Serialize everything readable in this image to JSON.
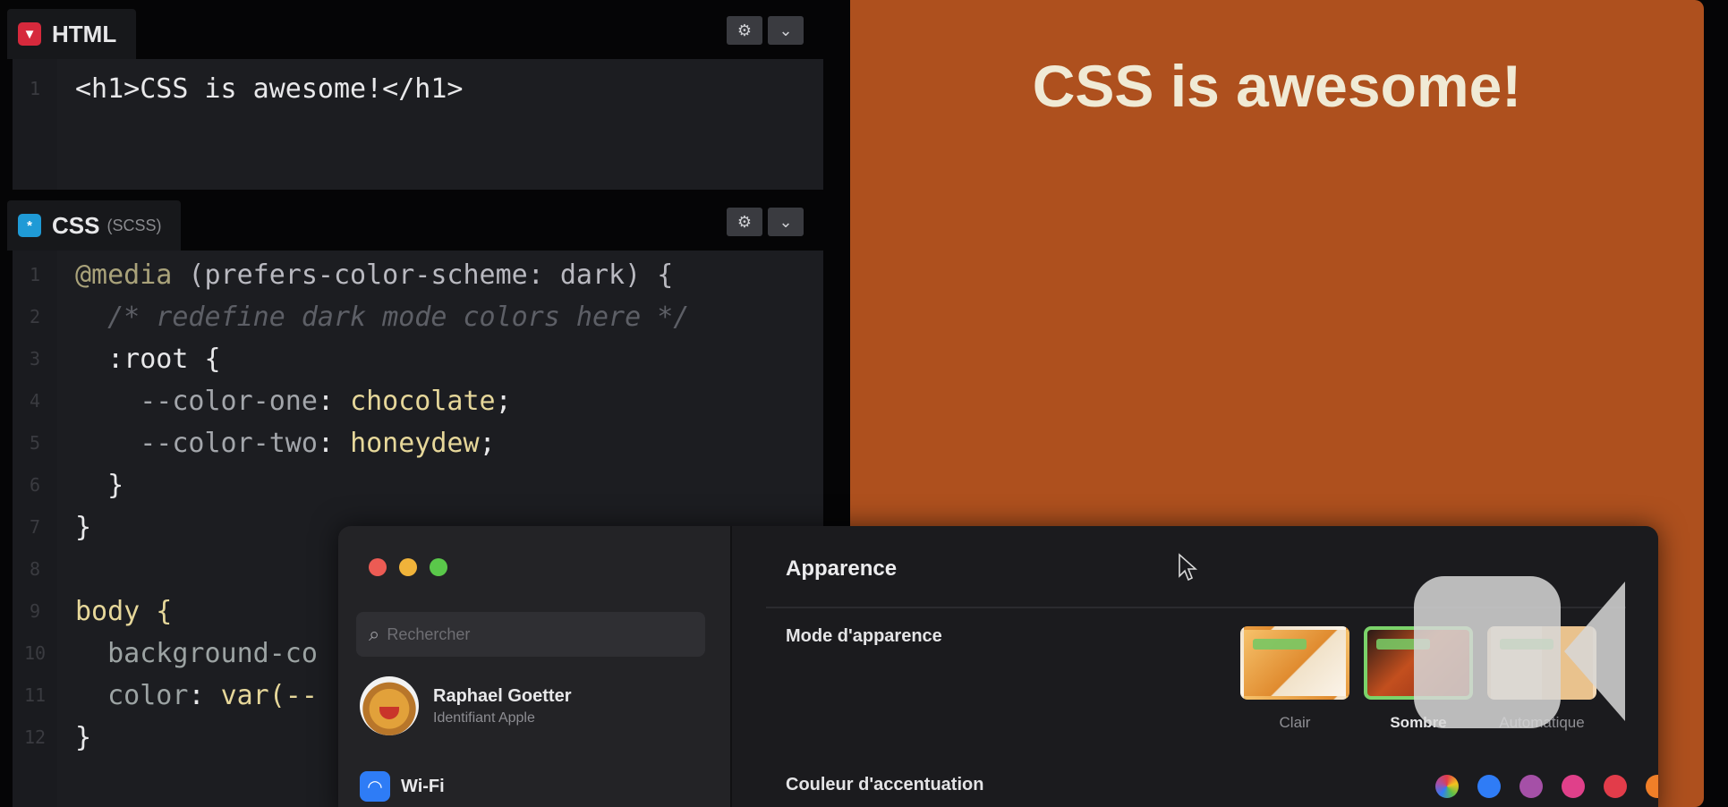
{
  "html_panel": {
    "tab_label": "HTML",
    "code": "<h1>CSS is awesome!</h1>"
  },
  "css_panel": {
    "tab_label": "CSS",
    "tab_sub": "(SCSS)",
    "lines": {
      "l1_at": "@media",
      "l1_rest": " (prefers-color-scheme: dark) {",
      "l2": "/* redefine dark mode colors here */",
      "l3": ":root {",
      "l4_prop": "--color-one",
      "l4_val": "chocolate",
      "l5_prop": "--color-two",
      "l5_val": "honeydew",
      "l6": "}",
      "l7": "}",
      "l8": "body {",
      "l9": "background-co",
      "l10_prop": "color",
      "l10_val": "var(--",
      "l11": "}"
    }
  },
  "preview": {
    "heading": "CSS is awesome!",
    "background": "#ae501e",
    "text_color": "#f0ead5"
  },
  "settings": {
    "search_placeholder": "Rechercher",
    "user_name": "Raphael Goetter",
    "user_sub": "Identifiant Apple",
    "wifi_label": "Wi-Fi",
    "pane_title": "Apparence",
    "mode_label": "Mode d'apparence",
    "modes": [
      "Clair",
      "Sombre",
      "Automatique"
    ],
    "selected_mode": "Sombre",
    "accent_label": "Couleur d'accentuation",
    "accent_colors": [
      "#c05be0",
      "#2f7cf6",
      "#a550a7",
      "#e0408a",
      "#e23c4a",
      "#f07f28",
      "#f2c21d",
      "#5bbf49",
      "#8d8d8d"
    ]
  },
  "icons": {
    "camera": "video-camera-icon",
    "cursor": "mouse-pointer-icon"
  }
}
